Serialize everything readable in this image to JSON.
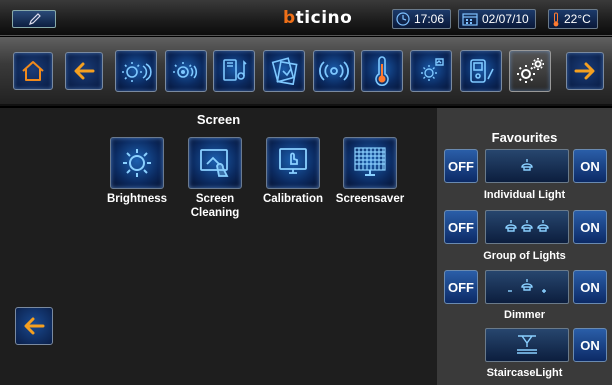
{
  "status_bar": {
    "brand": "bticino",
    "time": "17:06",
    "date": "02/07/10",
    "temperature": "22°C"
  },
  "toolbar": {
    "items": [
      {
        "icon": "home-icon",
        "active": false
      },
      {
        "icon": "arrow-left-icon",
        "active": false
      },
      {
        "icon": "lighting-icon",
        "active": false
      },
      {
        "icon": "automation-icon",
        "active": false
      },
      {
        "icon": "sound-system-icon",
        "active": false
      },
      {
        "icon": "scenarios-icon",
        "active": false
      },
      {
        "icon": "alarm-icon",
        "active": false
      },
      {
        "icon": "thermometer-icon",
        "active": false
      },
      {
        "icon": "energy-icon",
        "active": false
      },
      {
        "icon": "intercom-icon",
        "active": false
      },
      {
        "icon": "settings-icon",
        "active": true
      },
      {
        "icon": "arrow-right-icon",
        "active": false
      }
    ]
  },
  "screen": {
    "title": "Screen",
    "functions": [
      {
        "line1": "Brightness",
        "line2": ""
      },
      {
        "line1": "Screen",
        "line2": "Cleaning"
      },
      {
        "line1": "Calibration",
        "line2": ""
      },
      {
        "line1": "Screensaver",
        "line2": ""
      }
    ]
  },
  "favourites": {
    "title": "Favourites",
    "off_label": "OFF",
    "on_label": "ON",
    "items": [
      {
        "label": "Individual Light"
      },
      {
        "label": "Group of Lights"
      },
      {
        "label": "Dimmer"
      },
      {
        "label": "StaircaseLight"
      }
    ]
  },
  "colors": {
    "accent_orange": "#f07018",
    "button_blue": "#0b2a60",
    "panel_gray": "#3a3a3a",
    "main_bg": "#1e1e1e"
  }
}
